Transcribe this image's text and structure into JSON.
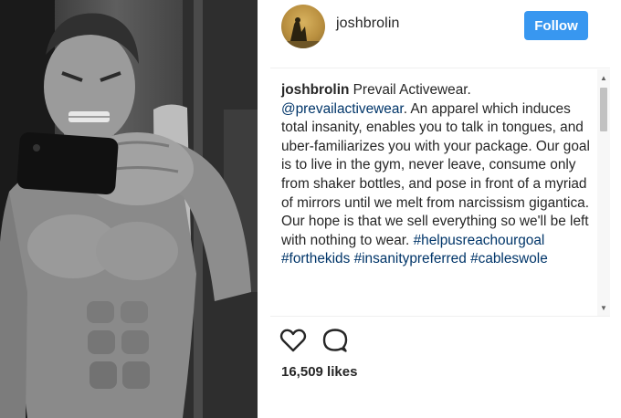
{
  "post": {
    "username": "joshbrolin",
    "follow_label": "Follow",
    "caption": {
      "author": "joshbrolin",
      "lead": "Prevail Activewear.",
      "mention": "@prevailactivewear",
      "body": ". An apparel which induces total insanity, enables you to talk in tongues, and uber-familiarizes you with your package. Our goal is to live in the gym, never leave, consume only from shaker bottles, and pose in front of a myriad of mirrors until we melt from narcissism gigantica. Our hope is that we sell everything so we'll be left with nothing to wear.",
      "hashtags": [
        "#helpusreachourgoal",
        "#forthekids",
        "#insanitypreferred",
        "#cableswole"
      ]
    },
    "likes_text": "16,509 likes"
  },
  "icons": {
    "like": "heart-icon",
    "comment": "comment-bubble-icon",
    "scroll_up": "scroll-up-arrow-icon",
    "scroll_down": "scroll-down-arrow-icon"
  },
  "colors": {
    "follow_button": "#3897f0",
    "link": "#003569",
    "text": "#262626",
    "divider": "#efefef"
  }
}
